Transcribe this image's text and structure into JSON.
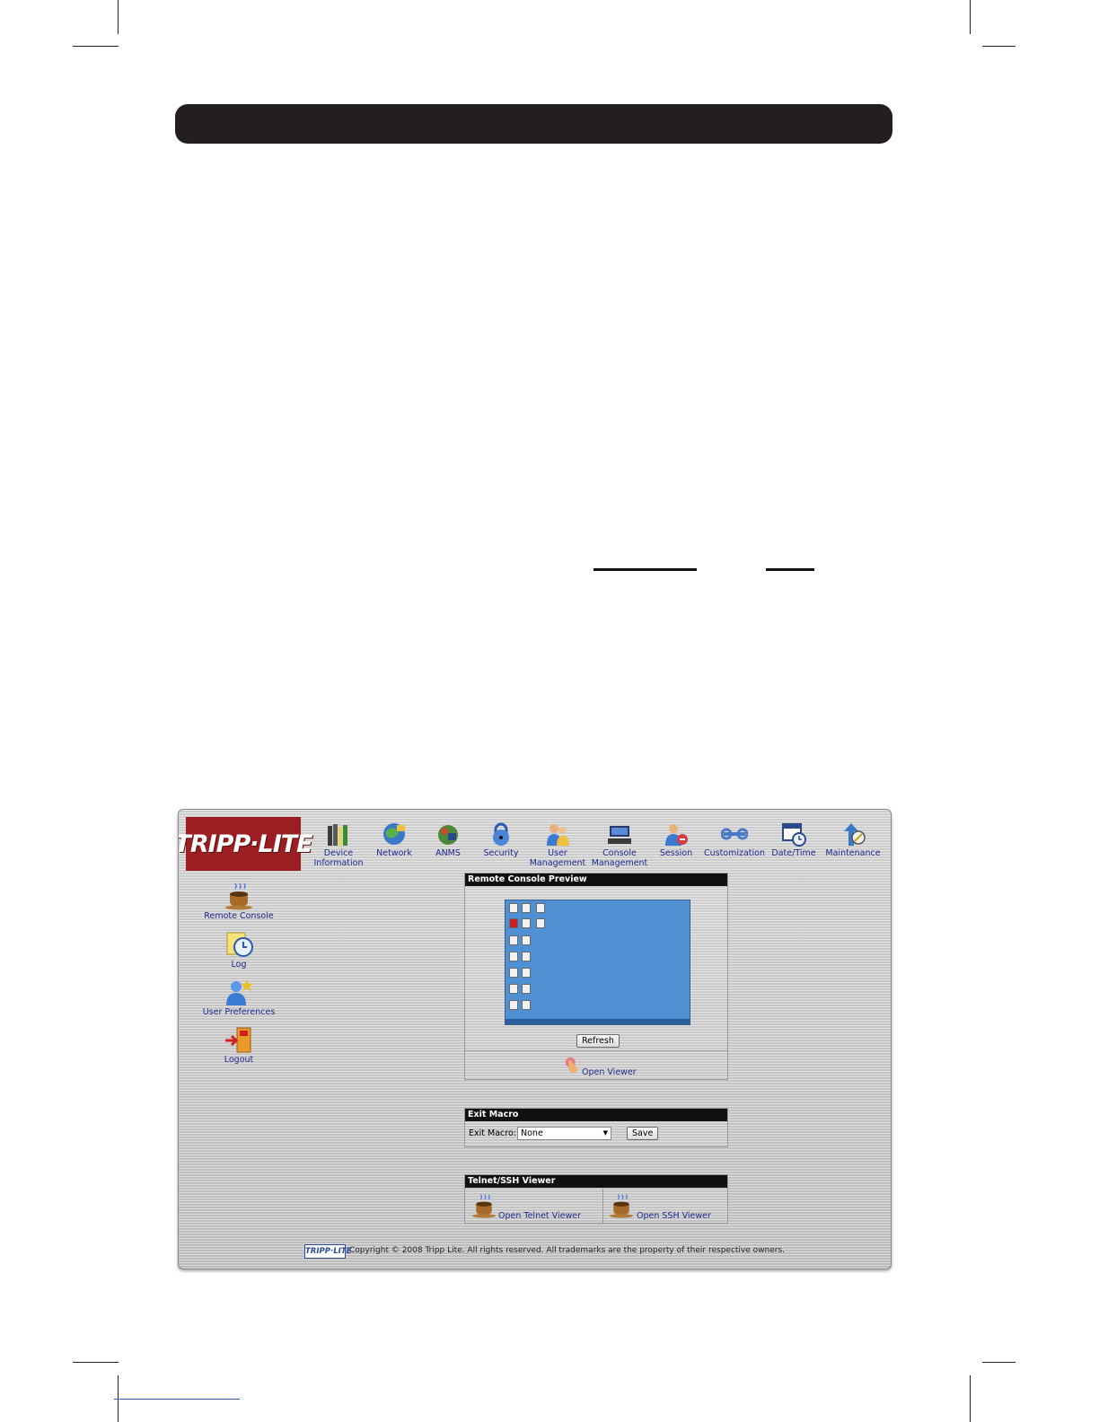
{
  "nav": [
    {
      "label_1": "Device",
      "label_2": "Information",
      "icon": "books-icon"
    },
    {
      "label_1": "Network",
      "label_2": "",
      "icon": "globe-network-icon"
    },
    {
      "label_1": "ANMS",
      "label_2": "",
      "icon": "anms-icon"
    },
    {
      "label_1": "Security",
      "label_2": "",
      "icon": "padlock-icon"
    },
    {
      "label_1": "User",
      "label_2": "Management",
      "icon": "users-icon"
    },
    {
      "label_1": "Console",
      "label_2": "Management",
      "icon": "console-icon"
    },
    {
      "label_1": "Session",
      "label_2": "",
      "icon": "session-icon"
    },
    {
      "label_1": "Customization",
      "label_2": "",
      "icon": "wrench-icon"
    },
    {
      "label_1": "Date/Time",
      "label_2": "",
      "icon": "calendar-clock-icon"
    },
    {
      "label_1": "Maintenance",
      "label_2": "",
      "icon": "maintenance-icon"
    }
  ],
  "logo_text": "TRIPP·LITE",
  "sidebar": [
    {
      "label": "Remote Console",
      "icon": "coffee-cup-icon"
    },
    {
      "label": "Log",
      "icon": "log-clock-icon"
    },
    {
      "label": "User Preferences",
      "icon": "user-star-icon"
    },
    {
      "label": "Logout",
      "icon": "exit-door-icon"
    }
  ],
  "preview": {
    "title": "Remote Console Preview",
    "refresh_label": "Refresh",
    "open_viewer_label": "Open Viewer"
  },
  "exit_macro": {
    "title": "Exit Macro",
    "field_label": "Exit Macro:",
    "selected": "None",
    "save_label": "Save"
  },
  "telnet": {
    "title": "Telnet/SSH Viewer",
    "open_telnet_label": "Open Telnet Viewer",
    "open_ssh_label": "Open SSH Viewer"
  },
  "footer": {
    "logo_text": "TRIPP·LITE",
    "copyright": "Copyright © 2008 Tripp Lite. All rights reserved. All trademarks are the property of their respective owners."
  },
  "colors": {
    "header_bar": "#231f20",
    "logo_red": "#9b1f22",
    "link_blue": "#1f2b8f",
    "preview_desktop": "#4f90d2"
  }
}
